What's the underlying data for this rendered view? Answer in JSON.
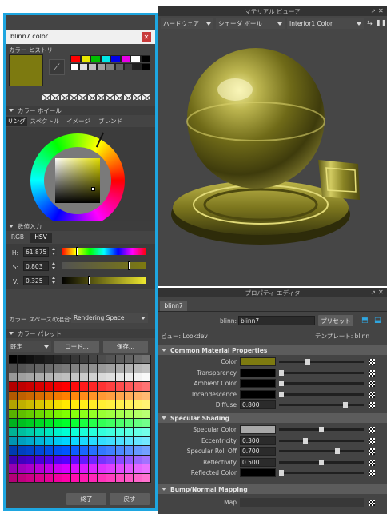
{
  "material_viewer": {
    "title": "マテリアル ビューア",
    "renderer": "ハードウェア",
    "shape": "シェーダ ボール",
    "material": "Interior1 Color"
  },
  "color_dialog": {
    "title": "blinn7.color",
    "history_label": "カラー ヒストリ",
    "wheel_section": "カラー ホイール",
    "wheel_tabs": [
      "リング",
      "スペクトル",
      "イメージ",
      "ブレンド"
    ],
    "numeric_section": "数値入力",
    "mode_tabs": [
      "RGB",
      "HSV"
    ],
    "h_label": "H:",
    "h_value": "61.875",
    "s_label": "S:",
    "s_value": "0.803",
    "v_label": "V:",
    "v_value": "0.325",
    "blend_label": "カラー スペースの混合:",
    "blend_value": "Rendering Space",
    "palette_section": "カラー パレット",
    "palette_mode": "既定",
    "load_button": "ロード...",
    "save_button": "保存...",
    "ok_button": "終了",
    "back_button": "戻す",
    "h_level": 0.17,
    "s_level": 0.803,
    "v_level": 0.325,
    "history_colors": [
      "#ff0000",
      "#e8e800",
      "#00c000",
      "#00e8e8",
      "#0000e8",
      "#e800e8",
      "#ffffff",
      "#000000"
    ],
    "current_color": "#7d7a10"
  },
  "attribute_editor": {
    "title": "プロパティ エディタ",
    "tab": "blinn7",
    "node_label": "blinn:",
    "node_value": "blinn7",
    "preset_button": "プリセット",
    "view_label": "ビュー: Lookdev",
    "template_label": "テンプレート: blinn",
    "sections": {
      "common": "Common Material Properties",
      "specular": "Specular Shading",
      "bump": "Bump/Normal Mapping"
    },
    "common_rows": [
      {
        "label": "Color",
        "swatch": "#7d7a10",
        "level": 0.33
      },
      {
        "label": "Transparency",
        "swatch": "#000000",
        "level": 0.0
      },
      {
        "label": "Ambient Color",
        "swatch": "#000000",
        "level": 0.0
      },
      {
        "label": "Incandescence",
        "swatch": "#000000",
        "level": 0.0
      },
      {
        "label": "Diffuse",
        "value": "0.800",
        "level": 0.8
      }
    ],
    "specular_rows": [
      {
        "label": "Specular Color",
        "swatch": "#a8a8a8",
        "level": 0.5
      },
      {
        "label": "Eccentricity",
        "value": "0.300",
        "level": 0.3
      },
      {
        "label": "Specular Roll Off",
        "value": "0.700",
        "level": 0.7
      },
      {
        "label": "Reflectivity",
        "value": "0.500",
        "level": 0.5
      },
      {
        "label": "Reflected Color",
        "swatch": "#000000",
        "level": 0.0
      }
    ],
    "bump_rows": [
      {
        "label": "Map"
      }
    ]
  }
}
